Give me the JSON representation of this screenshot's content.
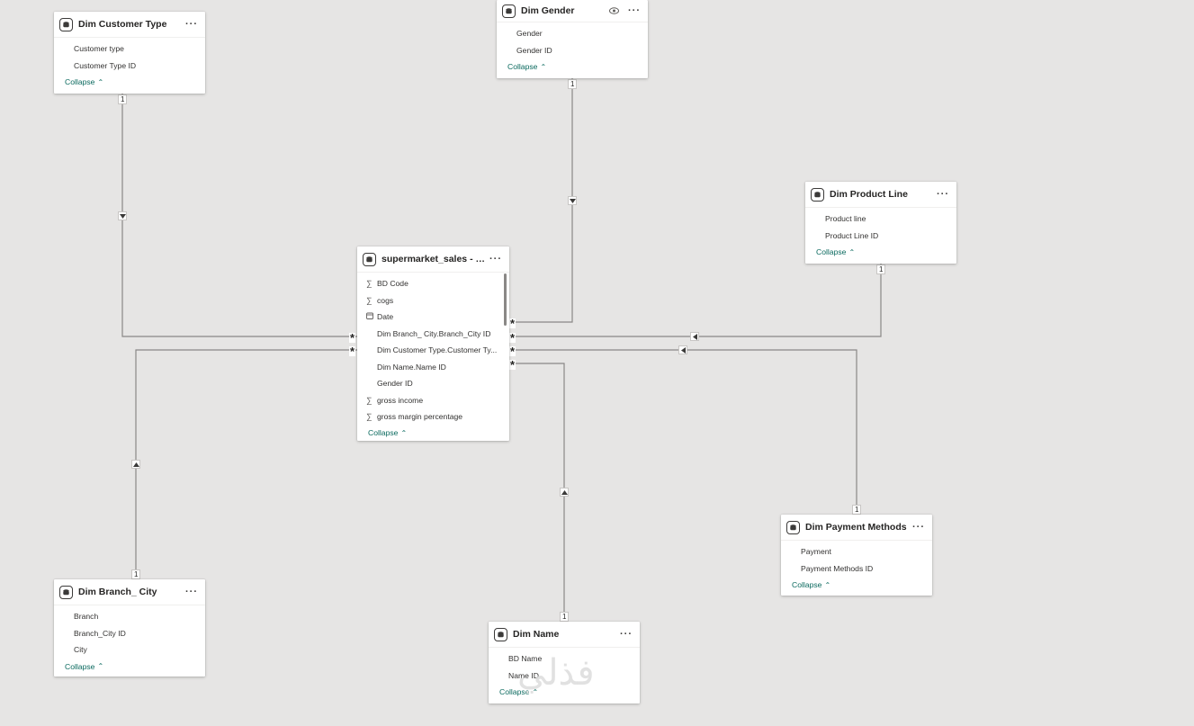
{
  "tables": {
    "customer_type": {
      "title": "Dim Customer Type",
      "fields": [
        "Customer type",
        "Customer Type ID"
      ],
      "collapse": "Collapse"
    },
    "gender": {
      "title": "Dim Gender",
      "fields": [
        "Gender",
        "Gender ID"
      ],
      "collapse": "Collapse"
    },
    "product_line": {
      "title": "Dim Product Line",
      "fields": [
        "Product line",
        "Product Line ID"
      ],
      "collapse": "Collapse"
    },
    "sales": {
      "title": "supermarket_sales - She...",
      "fields": [
        {
          "label": "BD Code",
          "icon": "sum-icon"
        },
        {
          "label": "cogs",
          "icon": "sum-icon"
        },
        {
          "label": "Date",
          "icon": "calendar-icon"
        },
        {
          "label": "Dim Branch_ City.Branch_City ID",
          "icon": ""
        },
        {
          "label": "Dim Customer Type.Customer Ty...",
          "icon": ""
        },
        {
          "label": "Dim Name.Name ID",
          "icon": ""
        },
        {
          "label": "Gender ID",
          "icon": ""
        },
        {
          "label": "gross income",
          "icon": "sum-icon"
        },
        {
          "label": "gross margin percentage",
          "icon": "sum-icon"
        }
      ],
      "collapse": "Collapse"
    },
    "branch_city": {
      "title": "Dim Branch_ City",
      "fields": [
        "Branch",
        "Branch_City ID",
        "City"
      ],
      "collapse": "Collapse"
    },
    "payment": {
      "title": "Dim Payment Methods",
      "fields": [
        "Payment",
        "Payment Methods ID"
      ],
      "collapse": "Collapse"
    },
    "name": {
      "title": "Dim Name",
      "fields": [
        "BD Name",
        "Name ID"
      ],
      "collapse": "Collapse"
    }
  },
  "cardinality": {
    "one": "1",
    "many": "*"
  },
  "glyphs": {
    "more": "···",
    "sum": "∑",
    "chevron_up": "⌃"
  },
  "watermark": "فذلي",
  "colors": {
    "canvas": "#e6e5e4",
    "accent": "#0b6a5f",
    "line": "#8a8886"
  }
}
